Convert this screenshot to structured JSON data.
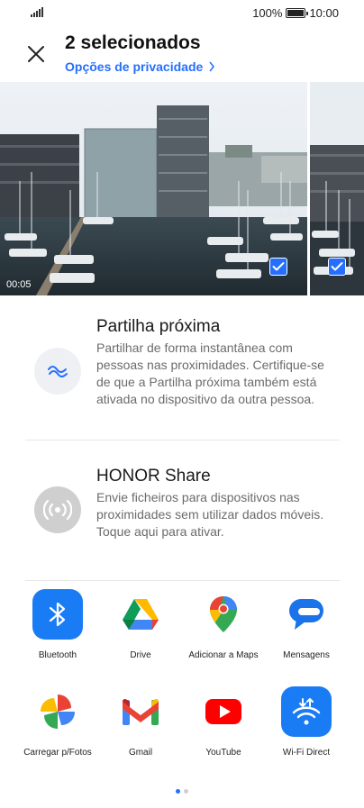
{
  "status_bar": {
    "battery": "100%",
    "time": "10:00"
  },
  "header": {
    "title": "2 selecionados",
    "subtitle": "Opções de privacidade"
  },
  "photos": [
    {
      "duration": "00:05",
      "selected": true
    },
    {
      "selected": true
    }
  ],
  "nearby_share": {
    "title": "Partilha próxima",
    "description": "Partilhar de forma instantânea com pessoas nas proximidades. Certifique-se de que a Partilha próxima também está ativada no dispositivo da outra pessoa."
  },
  "honor_share": {
    "title": "HONOR Share",
    "description": "Envie ficheiros para dispositivos nas proximidades sem utilizar dados móveis. Toque aqui para ativar."
  },
  "apps": [
    {
      "label": "Bluetooth",
      "icon": "bluetooth-icon"
    },
    {
      "label": "Drive",
      "icon": "google-drive-icon"
    },
    {
      "label": "Adicionar a Maps",
      "icon": "google-maps-icon"
    },
    {
      "label": "Mensagens",
      "icon": "messages-icon"
    },
    {
      "label": "Carregar p/Fotos",
      "icon": "google-photos-icon"
    },
    {
      "label": "Gmail",
      "icon": "gmail-icon"
    },
    {
      "label": "YouTube",
      "icon": "youtube-icon"
    },
    {
      "label": "Wi-Fi Direct",
      "icon": "wifi-direct-icon"
    }
  ],
  "pagination": {
    "pages": 2,
    "current": 1
  },
  "colors": {
    "accent": "#256fff",
    "check": "#256fff"
  }
}
